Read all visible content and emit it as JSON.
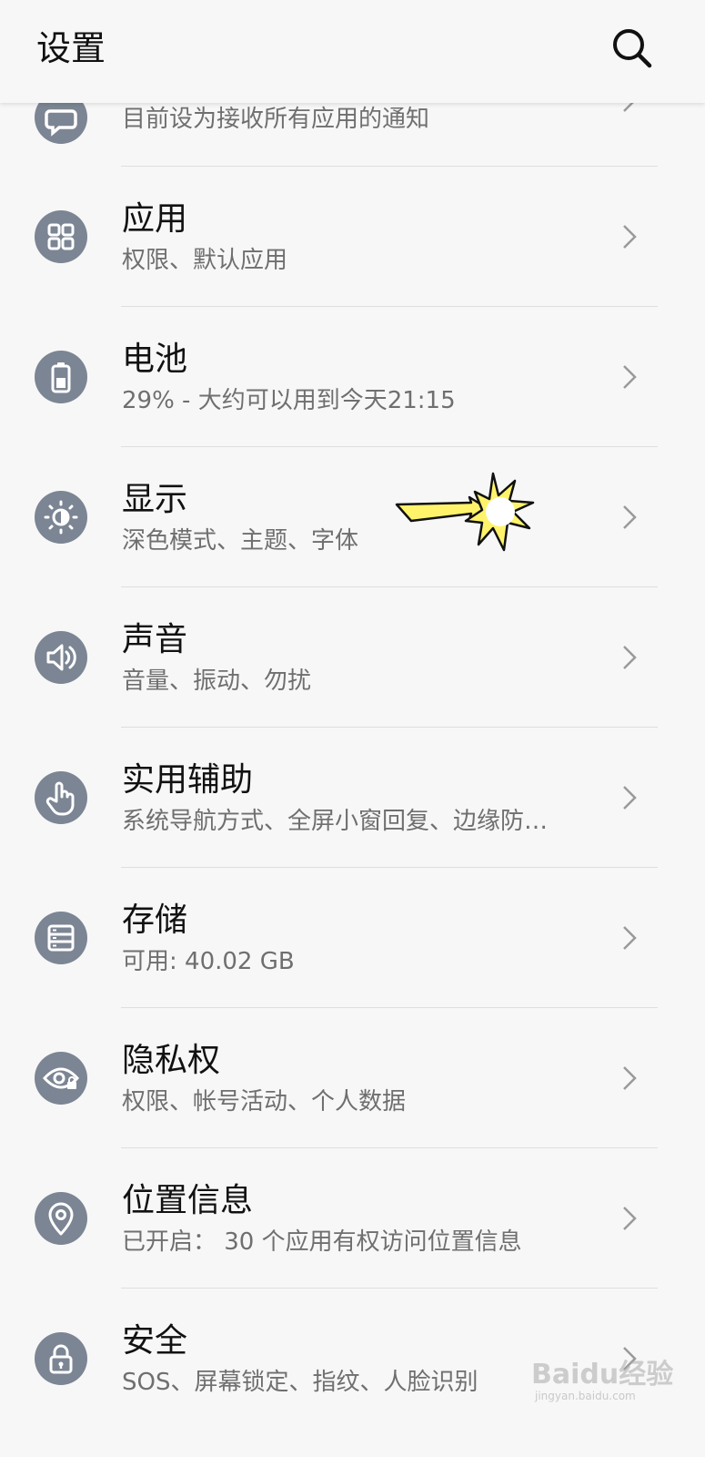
{
  "header": {
    "title": "设置",
    "search_icon": "search-icon"
  },
  "items": [
    {
      "id": "notifications",
      "title": "",
      "subtitle": "目前设为接收所有应用的通知",
      "icon": "notification-icon"
    },
    {
      "id": "apps",
      "title": "应用",
      "subtitle": "权限、默认应用",
      "icon": "apps-grid-icon"
    },
    {
      "id": "battery",
      "title": "电池",
      "subtitle": "29% - 大约可以用到今天21:15",
      "icon": "battery-icon"
    },
    {
      "id": "display",
      "title": "显示",
      "subtitle": "深色模式、主题、字体",
      "icon": "brightness-icon"
    },
    {
      "id": "sound",
      "title": "声音",
      "subtitle": "音量、振动、勿扰",
      "icon": "speaker-icon"
    },
    {
      "id": "accessibility",
      "title": "实用辅助",
      "subtitle": "系统导航方式、全屏小窗回复、边缘防…",
      "icon": "hand-pointer-icon"
    },
    {
      "id": "storage",
      "title": "存储",
      "subtitle": "可用: 40.02 GB",
      "icon": "storage-icon"
    },
    {
      "id": "privacy",
      "title": "隐私权",
      "subtitle": "权限、帐号活动、个人数据",
      "icon": "eye-lock-icon"
    },
    {
      "id": "location",
      "title": "位置信息",
      "subtitle": "已开启： 30 个应用有权访问位置信息",
      "icon": "location-pin-icon"
    },
    {
      "id": "security",
      "title": "安全",
      "subtitle": "SOS、屏幕锁定、指纹、人脸识别",
      "icon": "lock-icon"
    }
  ],
  "watermark": {
    "text": "Baidu经验",
    "url": "jingyan.baidu.com"
  },
  "colors": {
    "background": "#f7f7f7",
    "icon_circle": "#7c8593",
    "title_text": "#111111",
    "subtitle_text": "#6f6f6f",
    "divider": "#dedede",
    "pointer_fill": "#fff36b"
  }
}
